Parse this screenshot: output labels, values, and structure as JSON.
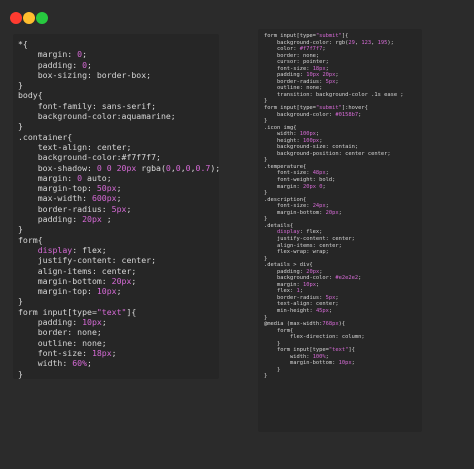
{
  "colors": {
    "close": "#ff3b30",
    "minimize": "#ffbd2e",
    "maximize": "#27c93f",
    "value": "#d66ad6",
    "text": "#d8d8d8"
  },
  "left_code": [
    [
      [
        "plain",
        "*{"
      ]
    ],
    [
      [
        "plain",
        "    "
      ],
      [
        "prop",
        "margin: "
      ],
      [
        "val",
        "0"
      ],
      [
        "plain",
        ";"
      ]
    ],
    [
      [
        "plain",
        "    "
      ],
      [
        "prop",
        "padding: "
      ],
      [
        "val",
        "0"
      ],
      [
        "plain",
        ";"
      ]
    ],
    [
      [
        "plain",
        "    "
      ],
      [
        "prop",
        "box-sizing: border-box;"
      ]
    ],
    [
      [
        "plain",
        "}"
      ]
    ],
    [
      [
        "plain",
        "body{"
      ]
    ],
    [
      [
        "plain",
        "    "
      ],
      [
        "prop",
        "font-family: sans-serif;"
      ]
    ],
    [
      [
        "plain",
        "    "
      ],
      [
        "prop",
        "background-color:aquamarine;"
      ]
    ],
    [
      [
        "plain",
        "}"
      ]
    ],
    [
      [
        "plain",
        ".container{"
      ]
    ],
    [
      [
        "plain",
        "    "
      ],
      [
        "prop",
        "text-align: center;"
      ]
    ],
    [
      [
        "plain",
        "    "
      ],
      [
        "prop",
        "background-color:#f7f7f7;"
      ]
    ],
    [
      [
        "plain",
        "    "
      ],
      [
        "prop",
        "box-shadow: "
      ],
      [
        "val",
        "0"
      ],
      [
        "plain",
        " "
      ],
      [
        "val",
        "0"
      ],
      [
        "plain",
        " "
      ],
      [
        "val",
        "20px"
      ],
      [
        "plain",
        " rgba("
      ],
      [
        "val",
        "0"
      ],
      [
        "plain",
        ","
      ],
      [
        "val",
        "0"
      ],
      [
        "plain",
        ","
      ],
      [
        "val",
        "0"
      ],
      [
        "plain",
        ","
      ],
      [
        "val",
        "0.7"
      ],
      [
        "plain",
        ");"
      ]
    ],
    [
      [
        "plain",
        "    "
      ],
      [
        "prop",
        "margin: "
      ],
      [
        "val",
        "0"
      ],
      [
        "plain",
        " auto;"
      ]
    ],
    [
      [
        "plain",
        "    "
      ],
      [
        "prop",
        "margin-top: "
      ],
      [
        "val",
        "50px"
      ],
      [
        "plain",
        ";"
      ]
    ],
    [
      [
        "plain",
        "    "
      ],
      [
        "prop",
        "max-width: "
      ],
      [
        "val",
        "600px"
      ],
      [
        "plain",
        ";"
      ]
    ],
    [
      [
        "plain",
        "    "
      ],
      [
        "prop",
        "border-radius: "
      ],
      [
        "val",
        "5px"
      ],
      [
        "plain",
        ";"
      ]
    ],
    [
      [
        "plain",
        "    "
      ],
      [
        "prop",
        "padding: "
      ],
      [
        "val",
        "20px"
      ],
      [
        "plain",
        " ;"
      ]
    ],
    [
      [
        "plain",
        "}"
      ]
    ],
    [
      [
        "plain",
        "form{"
      ]
    ],
    [
      [
        "plain",
        "    "
      ],
      [
        "val",
        "display"
      ],
      [
        "plain",
        ": flex;"
      ]
    ],
    [
      [
        "plain",
        "    "
      ],
      [
        "prop",
        "justify-content: center;"
      ]
    ],
    [
      [
        "plain",
        "    "
      ],
      [
        "prop",
        "align-items: center;"
      ]
    ],
    [
      [
        "plain",
        "    "
      ],
      [
        "prop",
        "margin-bottom: "
      ],
      [
        "val",
        "20px"
      ],
      [
        "plain",
        ";"
      ]
    ],
    [
      [
        "plain",
        "    "
      ],
      [
        "prop",
        "margin-top: "
      ],
      [
        "val",
        "10px"
      ],
      [
        "plain",
        ";"
      ]
    ],
    [
      [
        "plain",
        "}"
      ]
    ],
    [
      [
        "plain",
        "form input[type="
      ],
      [
        "str",
        "\"text\""
      ],
      [
        "plain",
        "]{"
      ]
    ],
    [
      [
        "plain",
        "    "
      ],
      [
        "prop",
        "padding: "
      ],
      [
        "val",
        "10px"
      ],
      [
        "plain",
        ";"
      ]
    ],
    [
      [
        "plain",
        "    "
      ],
      [
        "prop",
        "border: none;"
      ]
    ],
    [
      [
        "plain",
        "    "
      ],
      [
        "prop",
        "outline: none;"
      ]
    ],
    [
      [
        "plain",
        "    "
      ],
      [
        "prop",
        "font-size: "
      ],
      [
        "val",
        "18px"
      ],
      [
        "plain",
        ";"
      ]
    ],
    [
      [
        "plain",
        "    "
      ],
      [
        "prop",
        "width: "
      ],
      [
        "val",
        "60%"
      ],
      [
        "plain",
        ";"
      ]
    ],
    [
      [
        "plain",
        "}"
      ]
    ]
  ],
  "right_code": [
    [
      [
        "plain",
        "form input[type="
      ],
      [
        "str",
        "\"submit\""
      ],
      [
        "plain",
        "]{"
      ]
    ],
    [
      [
        "plain",
        "    "
      ],
      [
        "prop",
        "background-color: rgb("
      ],
      [
        "val",
        "29"
      ],
      [
        "plain",
        ", "
      ],
      [
        "val",
        "123"
      ],
      [
        "plain",
        ", "
      ],
      [
        "val",
        "195"
      ],
      [
        "plain",
        ");"
      ]
    ],
    [
      [
        "plain",
        "    "
      ],
      [
        "prop",
        "color: "
      ],
      [
        "val",
        "#f7f7f7"
      ],
      [
        "plain",
        ";"
      ]
    ],
    [
      [
        "plain",
        "    "
      ],
      [
        "prop",
        "border: none;"
      ]
    ],
    [
      [
        "plain",
        "    "
      ],
      [
        "prop",
        "cursor: pointer;"
      ]
    ],
    [
      [
        "plain",
        "    "
      ],
      [
        "prop",
        "font-size: "
      ],
      [
        "val",
        "18px"
      ],
      [
        "plain",
        ";"
      ]
    ],
    [
      [
        "plain",
        "    "
      ],
      [
        "prop",
        "padding: "
      ],
      [
        "val",
        "10px"
      ],
      [
        "plain",
        " "
      ],
      [
        "val",
        "20px"
      ],
      [
        "plain",
        ";"
      ]
    ],
    [
      [
        "plain",
        "    "
      ],
      [
        "prop",
        "border-radius: "
      ],
      [
        "val",
        "5px"
      ],
      [
        "plain",
        ";"
      ]
    ],
    [
      [
        "plain",
        "    "
      ],
      [
        "prop",
        "outline: none;"
      ]
    ],
    [
      [
        "plain",
        "    "
      ],
      [
        "prop",
        "transition: background-color .1s ease ;"
      ]
    ],
    [
      [
        "plain",
        "}"
      ]
    ],
    [
      [
        "plain",
        "form input[type="
      ],
      [
        "str",
        "\"submit\""
      ],
      [
        "plain",
        "]:hover{"
      ]
    ],
    [
      [
        "plain",
        "    "
      ],
      [
        "prop",
        "background-color: "
      ],
      [
        "val",
        "#0158b7"
      ],
      [
        "plain",
        ";"
      ]
    ],
    [
      [
        "plain",
        "}"
      ]
    ],
    [
      [
        "plain",
        ".icon img{"
      ]
    ],
    [
      [
        "plain",
        "    "
      ],
      [
        "prop",
        "width: "
      ],
      [
        "val",
        "100px"
      ],
      [
        "plain",
        ";"
      ]
    ],
    [
      [
        "plain",
        "    "
      ],
      [
        "prop",
        "height: "
      ],
      [
        "val",
        "100px"
      ],
      [
        "plain",
        ";"
      ]
    ],
    [
      [
        "plain",
        "    "
      ],
      [
        "prop",
        "background-size: contain;"
      ]
    ],
    [
      [
        "plain",
        "    "
      ],
      [
        "prop",
        "background-position: center center;"
      ]
    ],
    [
      [
        "plain",
        "}"
      ]
    ],
    [
      [
        "plain",
        ".temperature{"
      ]
    ],
    [
      [
        "plain",
        "    "
      ],
      [
        "prop",
        "font-size: "
      ],
      [
        "val",
        "48px"
      ],
      [
        "plain",
        ";"
      ]
    ],
    [
      [
        "plain",
        "    "
      ],
      [
        "prop",
        "font-weight: bold;"
      ]
    ],
    [
      [
        "plain",
        "    "
      ],
      [
        "prop",
        "margin: "
      ],
      [
        "val",
        "20px"
      ],
      [
        "plain",
        " "
      ],
      [
        "val",
        "0"
      ],
      [
        "plain",
        ";"
      ]
    ],
    [
      [
        "plain",
        "}"
      ]
    ],
    [
      [
        "plain",
        ".description{"
      ]
    ],
    [
      [
        "plain",
        "    "
      ],
      [
        "prop",
        "font-size: "
      ],
      [
        "val",
        "24px"
      ],
      [
        "plain",
        ";"
      ]
    ],
    [
      [
        "plain",
        "    "
      ],
      [
        "prop",
        "margin-bottom: "
      ],
      [
        "val",
        "20px"
      ],
      [
        "plain",
        ";"
      ]
    ],
    [
      [
        "plain",
        "}"
      ]
    ],
    [
      [
        "plain",
        ".details{"
      ]
    ],
    [
      [
        "plain",
        "    "
      ],
      [
        "val",
        "display"
      ],
      [
        "plain",
        ": flex;"
      ]
    ],
    [
      [
        "plain",
        "    "
      ],
      [
        "prop",
        "justify-content: center;"
      ]
    ],
    [
      [
        "plain",
        "    "
      ],
      [
        "prop",
        "align-items: center;"
      ]
    ],
    [
      [
        "plain",
        "    "
      ],
      [
        "prop",
        "flex-wrap: wrap;"
      ]
    ],
    [
      [
        "plain",
        "}"
      ]
    ],
    [
      [
        "plain",
        ".details > div{"
      ]
    ],
    [
      [
        "plain",
        "    "
      ],
      [
        "prop",
        "padding: "
      ],
      [
        "val",
        "20px"
      ],
      [
        "plain",
        ";"
      ]
    ],
    [
      [
        "plain",
        "    "
      ],
      [
        "prop",
        "background-color: "
      ],
      [
        "val",
        "#e2e2e2"
      ],
      [
        "plain",
        ";"
      ]
    ],
    [
      [
        "plain",
        "    "
      ],
      [
        "prop",
        "margin: "
      ],
      [
        "val",
        "10px"
      ],
      [
        "plain",
        ";"
      ]
    ],
    [
      [
        "plain",
        "    "
      ],
      [
        "prop",
        "flex: "
      ],
      [
        "val",
        "1"
      ],
      [
        "plain",
        ";"
      ]
    ],
    [
      [
        "plain",
        "    "
      ],
      [
        "prop",
        "border-radius: "
      ],
      [
        "val",
        "5px"
      ],
      [
        "plain",
        ";"
      ]
    ],
    [
      [
        "plain",
        "    "
      ],
      [
        "prop",
        "text-align: center;"
      ]
    ],
    [
      [
        "plain",
        "    "
      ],
      [
        "prop",
        "min-height: "
      ],
      [
        "val",
        "45px"
      ],
      [
        "plain",
        ";"
      ]
    ],
    [
      [
        "plain",
        "}"
      ]
    ],
    [
      [
        "plain",
        "@media (max-width:"
      ],
      [
        "val",
        "768px"
      ],
      [
        "plain",
        "){"
      ]
    ],
    [
      [
        "plain",
        "    form{"
      ]
    ],
    [
      [
        "plain",
        "        "
      ],
      [
        "prop",
        "flex-direction: column;"
      ]
    ],
    [
      [
        "plain",
        "    }"
      ]
    ],
    [
      [
        "plain",
        "    form input[type="
      ],
      [
        "str",
        "\"text\""
      ],
      [
        "plain",
        "]{"
      ]
    ],
    [
      [
        "plain",
        "        "
      ],
      [
        "prop",
        "width: "
      ],
      [
        "val",
        "100%"
      ],
      [
        "plain",
        ";"
      ]
    ],
    [
      [
        "plain",
        "        "
      ],
      [
        "prop",
        "margin-bottom: "
      ],
      [
        "val",
        "10px"
      ],
      [
        "plain",
        ";"
      ]
    ],
    [
      [
        "plain",
        "    }"
      ]
    ],
    [
      [
        "plain",
        "}"
      ]
    ]
  ]
}
